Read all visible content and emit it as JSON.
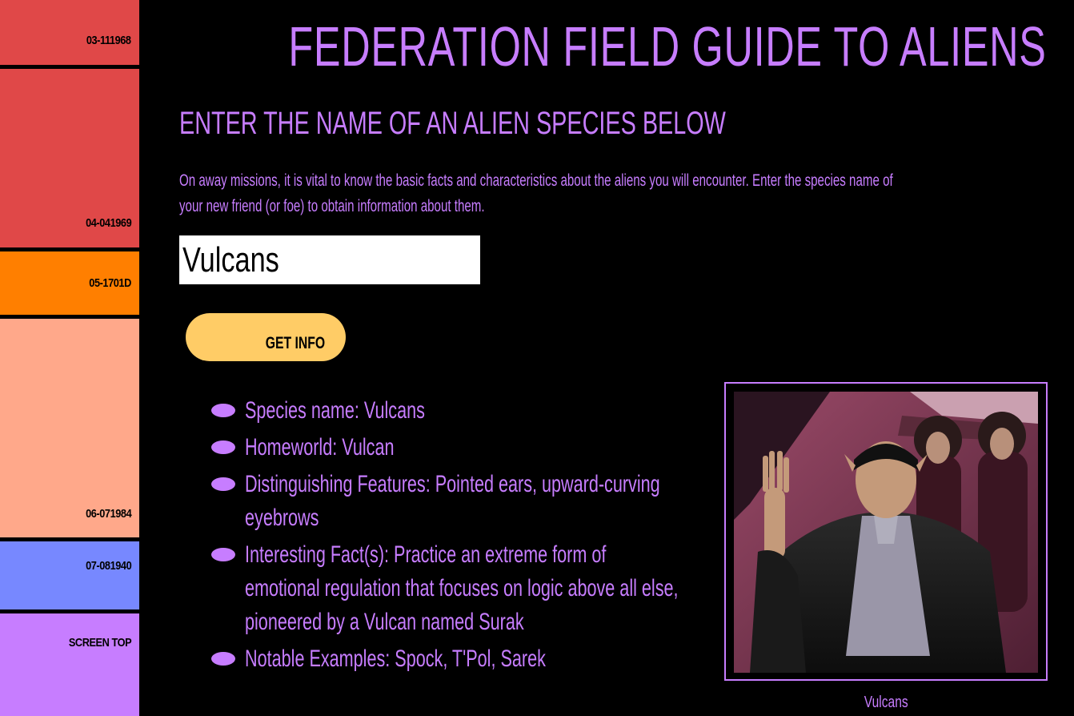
{
  "sidebar": {
    "blocks": [
      {
        "label": "03-111968",
        "color": "#e04848"
      },
      {
        "label": "04-041969",
        "color": "#e04848"
      },
      {
        "label": "05-1701D",
        "color": "#ff7f00"
      },
      {
        "label": "06-071984",
        "color": "#ffa88a"
      },
      {
        "label": "07-081940",
        "color": "#7788ff"
      },
      {
        "label": "SCREEN TOP",
        "color": "#c77dff"
      }
    ]
  },
  "header": {
    "title": "FEDERATION FIELD GUIDE TO ALIENS",
    "subtitle": "ENTER THE NAME OF AN ALIEN SPECIES BELOW",
    "intro_line1": "On away missions, it is vital to know the basic facts and characteristics about the aliens you will encounter. Enter the species name of",
    "intro_line2": "your new friend (or foe) to obtain information about them."
  },
  "search": {
    "value": "Vulcans"
  },
  "button": {
    "label": "GET INFO",
    "color": "#ffcc66"
  },
  "info": {
    "species": "Species name: Vulcans",
    "homeworld": "Homeworld: Vulcan",
    "features": "Distinguishing Features: Pointed ears, upward-curving eyebrows",
    "fact": "Interesting Fact(s): Practice an extreme form of emotional regulation that focuses on logic above all else, pioneered by a Vulcan named Surak",
    "examples": "Notable Examples: Spock, T'Pol, Sarek"
  },
  "image": {
    "caption": "Vulcans"
  },
  "colors": {
    "accent": "#c77dff",
    "background": "#000000"
  }
}
